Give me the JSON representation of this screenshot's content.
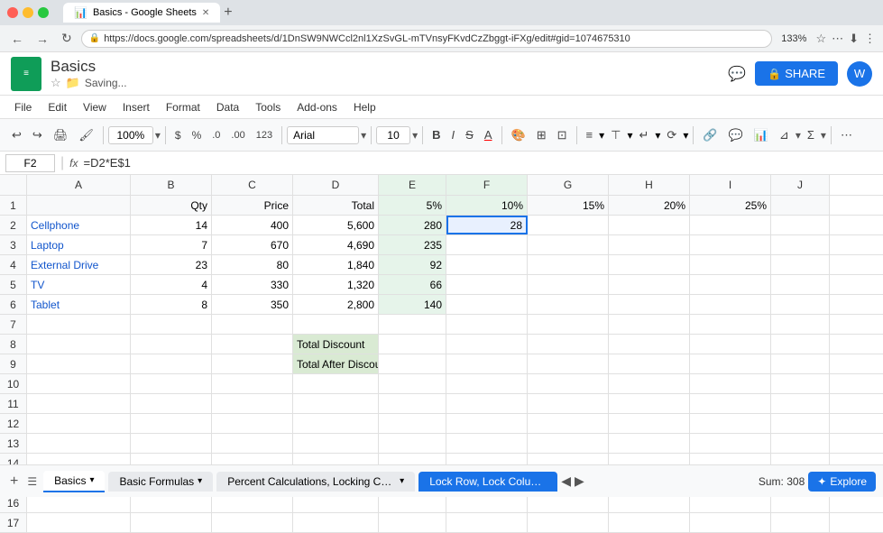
{
  "browser": {
    "tab_title": "Basics - Google Sheets",
    "url": "https://docs.google.com/spreadsheets/d/1DnSW9NWCcl2nl1XzSvGL-mTVnsyFKvdCzZbggt-iFXg/edit#gid=1074675310",
    "zoom": "133%"
  },
  "app": {
    "logo_letter": "",
    "title": "Basics",
    "saving": "Saving..."
  },
  "menu": {
    "items": [
      "File",
      "Edit",
      "View",
      "Insert",
      "Format",
      "Data",
      "Tools",
      "Add-ons",
      "Help"
    ]
  },
  "toolbar": {
    "zoom": "100%",
    "font": "Arial",
    "size": "10"
  },
  "formula_bar": {
    "cell_ref": "F2",
    "formula": "=D2*E$1"
  },
  "spreadsheet": {
    "col_headers": [
      "",
      "A",
      "B",
      "C",
      "D",
      "E",
      "F",
      "G",
      "H",
      "I",
      "J"
    ],
    "row1": [
      "",
      "",
      "Qty",
      "Price",
      "Total",
      "5%",
      "10%",
      "15%",
      "20%",
      "25%",
      ""
    ],
    "rows": [
      {
        "num": "2",
        "a": "Cellphone",
        "b": "14",
        "c": "400",
        "d": "5,600",
        "e": "280",
        "f": "28",
        "g": "",
        "h": "",
        "i": "",
        "j": ""
      },
      {
        "num": "3",
        "a": "Laptop",
        "b": "7",
        "c": "670",
        "d": "4,690",
        "e": "235",
        "f": "",
        "g": "",
        "h": "",
        "i": "",
        "j": ""
      },
      {
        "num": "4",
        "a": "External Drive",
        "b": "23",
        "c": "80",
        "d": "1,840",
        "e": "92",
        "f": "",
        "g": "",
        "h": "",
        "i": "",
        "j": ""
      },
      {
        "num": "5",
        "a": "TV",
        "b": "4",
        "c": "330",
        "d": "1,320",
        "e": "66",
        "f": "",
        "g": "",
        "h": "",
        "i": "",
        "j": ""
      },
      {
        "num": "6",
        "a": "Tablet",
        "b": "8",
        "c": "350",
        "d": "2,800",
        "e": "140",
        "f": "",
        "g": "",
        "h": "",
        "i": "",
        "j": ""
      },
      {
        "num": "7",
        "a": "",
        "b": "",
        "c": "",
        "d": "",
        "e": "",
        "f": "",
        "g": "",
        "h": "",
        "i": "",
        "j": ""
      },
      {
        "num": "8",
        "a": "",
        "b": "",
        "c": "",
        "d": "Total Discount",
        "e": "",
        "f": "",
        "g": "",
        "h": "",
        "i": "",
        "j": ""
      },
      {
        "num": "9",
        "a": "",
        "b": "",
        "c": "",
        "d": "Total After Discount",
        "e": "",
        "f": "",
        "g": "",
        "h": "",
        "i": "",
        "j": ""
      },
      {
        "num": "10",
        "a": "",
        "b": "",
        "c": "",
        "d": "",
        "e": "",
        "f": "",
        "g": "",
        "h": "",
        "i": "",
        "j": ""
      },
      {
        "num": "11",
        "a": "",
        "b": "",
        "c": "",
        "d": "",
        "e": "",
        "f": "",
        "g": "",
        "h": "",
        "i": "",
        "j": ""
      },
      {
        "num": "12",
        "a": "",
        "b": "",
        "c": "",
        "d": "",
        "e": "",
        "f": "",
        "g": "",
        "h": "",
        "i": "",
        "j": ""
      },
      {
        "num": "13",
        "a": "",
        "b": "",
        "c": "",
        "d": "",
        "e": "",
        "f": "",
        "g": "",
        "h": "",
        "i": "",
        "j": ""
      },
      {
        "num": "14",
        "a": "",
        "b": "",
        "c": "",
        "d": "",
        "e": "",
        "f": "",
        "g": "",
        "h": "",
        "i": "",
        "j": ""
      },
      {
        "num": "15",
        "a": "",
        "b": "",
        "c": "",
        "d": "",
        "e": "",
        "f": "",
        "g": "",
        "h": "",
        "i": "",
        "j": ""
      },
      {
        "num": "16",
        "a": "",
        "b": "",
        "c": "",
        "d": "",
        "e": "",
        "f": "",
        "g": "",
        "h": "",
        "i": "",
        "j": ""
      },
      {
        "num": "17",
        "a": "",
        "b": "",
        "c": "",
        "d": "",
        "e": "",
        "f": "",
        "g": "",
        "h": "",
        "i": "",
        "j": ""
      }
    ]
  },
  "sheet_tabs": [
    {
      "label": "Basics",
      "active": true
    },
    {
      "label": "Basic Formulas",
      "active": false
    },
    {
      "label": "Percent Calculations, Locking Cells, % of Total",
      "active": false
    },
    {
      "label": "Lock Row, Lock Colum...",
      "active": false
    }
  ],
  "status": {
    "sum": "Sum: 308",
    "explore": "Explore"
  },
  "labels": {
    "total_discount": "Total Discount",
    "total_after_discount": "Total After Discount",
    "share": "SHARE",
    "saving": "Saving..."
  }
}
